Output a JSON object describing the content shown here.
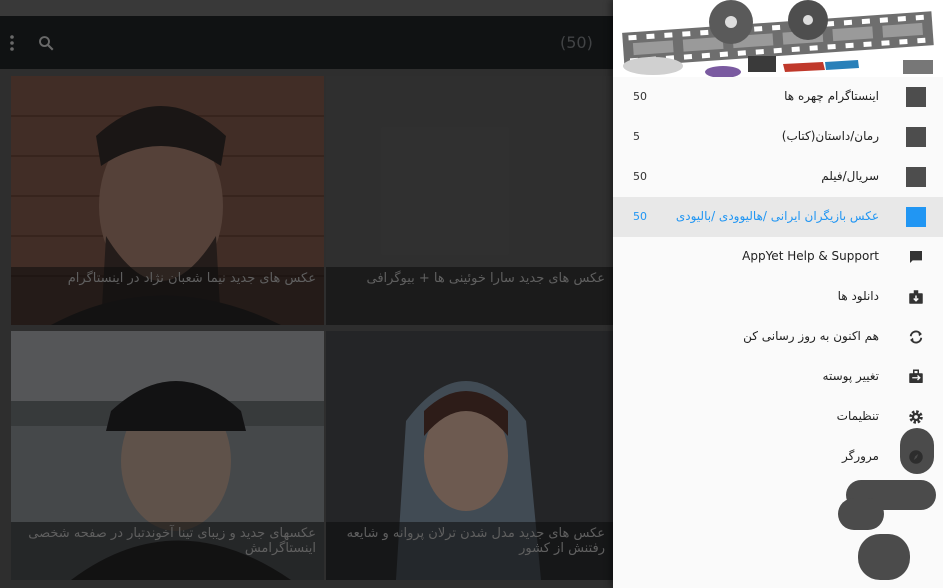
{
  "toolbar": {
    "count_label": "(50)",
    "search_icon": "search-icon",
    "more_icon": "more-vert-icon"
  },
  "cards": [
    {
      "title": "عکس های جدید نیما شعبان نژاد در اینستاگرام"
    },
    {
      "title": "عکس های جدید سارا خوئینی ها + بیوگرافی"
    },
    {
      "title": "عکسهای جدید و زیبای تینا آخوندتبار در صفحه شخصی اینستاگرامش"
    },
    {
      "title": "عکس های جدید مدل شدن ترلان پروانه و شایعه رفتنش از کشور"
    }
  ],
  "drawer": {
    "categories": [
      {
        "label": "اینستاگرام چهره ها",
        "count": "50"
      },
      {
        "label": "رمان/داستان(کتاب)",
        "count": "5"
      },
      {
        "label": "سریال/فیلم",
        "count": "50"
      },
      {
        "label": "عکس بازیگران ایرانی /هالیوودی /بالیودی",
        "count": "50"
      }
    ],
    "actions": [
      {
        "label": "AppYet Help & Support",
        "icon": "chat-icon"
      },
      {
        "label": "دانلود ها",
        "icon": "download-icon"
      },
      {
        "label": "هم اکنون به روز رسانی کن",
        "icon": "sync-icon"
      },
      {
        "label": "تغییر پوسته",
        "icon": "theme-icon"
      },
      {
        "label": "تنظیمات",
        "icon": "settings-icon"
      },
      {
        "label": "مرورگر",
        "icon": "compass-icon"
      }
    ]
  },
  "colors": {
    "accent": "#2196f3",
    "toolbar": "#1b1e20",
    "drawer_bg": "#fafafa"
  }
}
